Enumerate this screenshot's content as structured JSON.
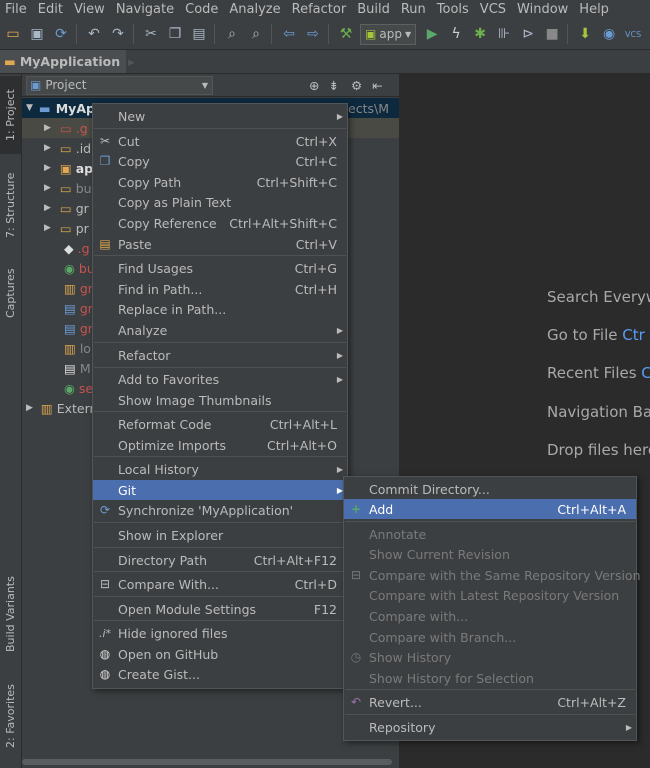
{
  "menubar": [
    "File",
    "Edit",
    "View",
    "Navigate",
    "Code",
    "Analyze",
    "Refactor",
    "Build",
    "Run",
    "Tools",
    "VCS",
    "Window",
    "Help"
  ],
  "toolbar": {
    "run_config": "app"
  },
  "breadcrumb": "MyApplication",
  "sidebar_left": {
    "tab_project": "1: Project",
    "tab_structure": "7: Structure",
    "tab_captures": "Captures",
    "tab_build_variants": "Build Variants",
    "tab_favorites": "2: Favorites"
  },
  "project_panel": {
    "view_label": "Project",
    "root_label": "MyApplication",
    "root_path": "C:\\Users\\...\\AndroidStudioProjects\\M",
    "rows": [
      ".g",
      ".id",
      "ap",
      "bu",
      "gr",
      "pr",
      ".g",
      "bu",
      "gr",
      "gr",
      "gr",
      "lo",
      "M",
      "se",
      "Extern"
    ]
  },
  "editor_hints": [
    {
      "text": "Search Everyw",
      "key": ""
    },
    {
      "text": "Go to File ",
      "key": "Ctr"
    },
    {
      "text": "Recent Files ",
      "key": "C"
    },
    {
      "text": "Navigation Ba",
      "key": ""
    },
    {
      "text": "Drop files here",
      "key": ""
    }
  ],
  "context_menu": [
    {
      "label": "New",
      "shortcut": "",
      "submenu": true
    },
    {
      "label": "Cut",
      "shortcut": "Ctrl+X"
    },
    {
      "label": "Copy",
      "shortcut": "Ctrl+C"
    },
    {
      "label": "Copy Path",
      "shortcut": "Ctrl+Shift+C"
    },
    {
      "label": "Copy as Plain Text",
      "shortcut": ""
    },
    {
      "label": "Copy Reference",
      "shortcut": "Ctrl+Alt+Shift+C"
    },
    {
      "label": "Paste",
      "shortcut": "Ctrl+V"
    },
    {
      "label": "Find Usages",
      "shortcut": "Ctrl+G"
    },
    {
      "label": "Find in Path...",
      "shortcut": "Ctrl+H"
    },
    {
      "label": "Replace in Path...",
      "shortcut": ""
    },
    {
      "label": "Analyze",
      "shortcut": "",
      "submenu": true
    },
    {
      "label": "Refactor",
      "shortcut": "",
      "submenu": true
    },
    {
      "label": "Add to Favorites",
      "shortcut": "",
      "submenu": true
    },
    {
      "label": "Show Image Thumbnails",
      "shortcut": ""
    },
    {
      "label": "Reformat Code",
      "shortcut": "Ctrl+Alt+L"
    },
    {
      "label": "Optimize Imports",
      "shortcut": "Ctrl+Alt+O"
    },
    {
      "label": "Local History",
      "shortcut": "",
      "submenu": true
    },
    {
      "label": "Git",
      "shortcut": "",
      "submenu": true,
      "selected": true
    },
    {
      "label": "Synchronize 'MyApplication'",
      "shortcut": ""
    },
    {
      "label": "Show in Explorer",
      "shortcut": ""
    },
    {
      "label": "Directory Path",
      "shortcut": "Ctrl+Alt+F12"
    },
    {
      "label": "Compare With...",
      "shortcut": "Ctrl+D"
    },
    {
      "label": "Open Module Settings",
      "shortcut": "F12"
    },
    {
      "label": "Hide ignored files",
      "shortcut": ""
    },
    {
      "label": "Open on GitHub",
      "shortcut": ""
    },
    {
      "label": "Create Gist...",
      "shortcut": ""
    }
  ],
  "git_submenu": [
    {
      "label": "Commit Directory...",
      "shortcut": ""
    },
    {
      "label": "Add",
      "shortcut": "Ctrl+Alt+A",
      "selected": true
    },
    {
      "label": "Annotate",
      "shortcut": "",
      "disabled": true
    },
    {
      "label": "Show Current Revision",
      "shortcut": "",
      "disabled": true
    },
    {
      "label": "Compare with the Same Repository Version",
      "shortcut": "",
      "disabled": true
    },
    {
      "label": "Compare with Latest Repository Version",
      "shortcut": "",
      "disabled": true
    },
    {
      "label": "Compare with...",
      "shortcut": "",
      "disabled": true
    },
    {
      "label": "Compare with Branch...",
      "shortcut": "",
      "disabled": true
    },
    {
      "label": "Show History",
      "shortcut": "",
      "disabled": true
    },
    {
      "label": "Show History for Selection",
      "shortcut": "",
      "disabled": true
    },
    {
      "label": "Revert...",
      "shortcut": "Ctrl+Alt+Z"
    },
    {
      "label": "Repository",
      "shortcut": "",
      "submenu": true
    }
  ],
  "colors": {
    "selection": "#4b6eaf",
    "menu_bg": "#3c3f41",
    "editor_bg": "#2b2b2b",
    "link": "#589df6"
  }
}
